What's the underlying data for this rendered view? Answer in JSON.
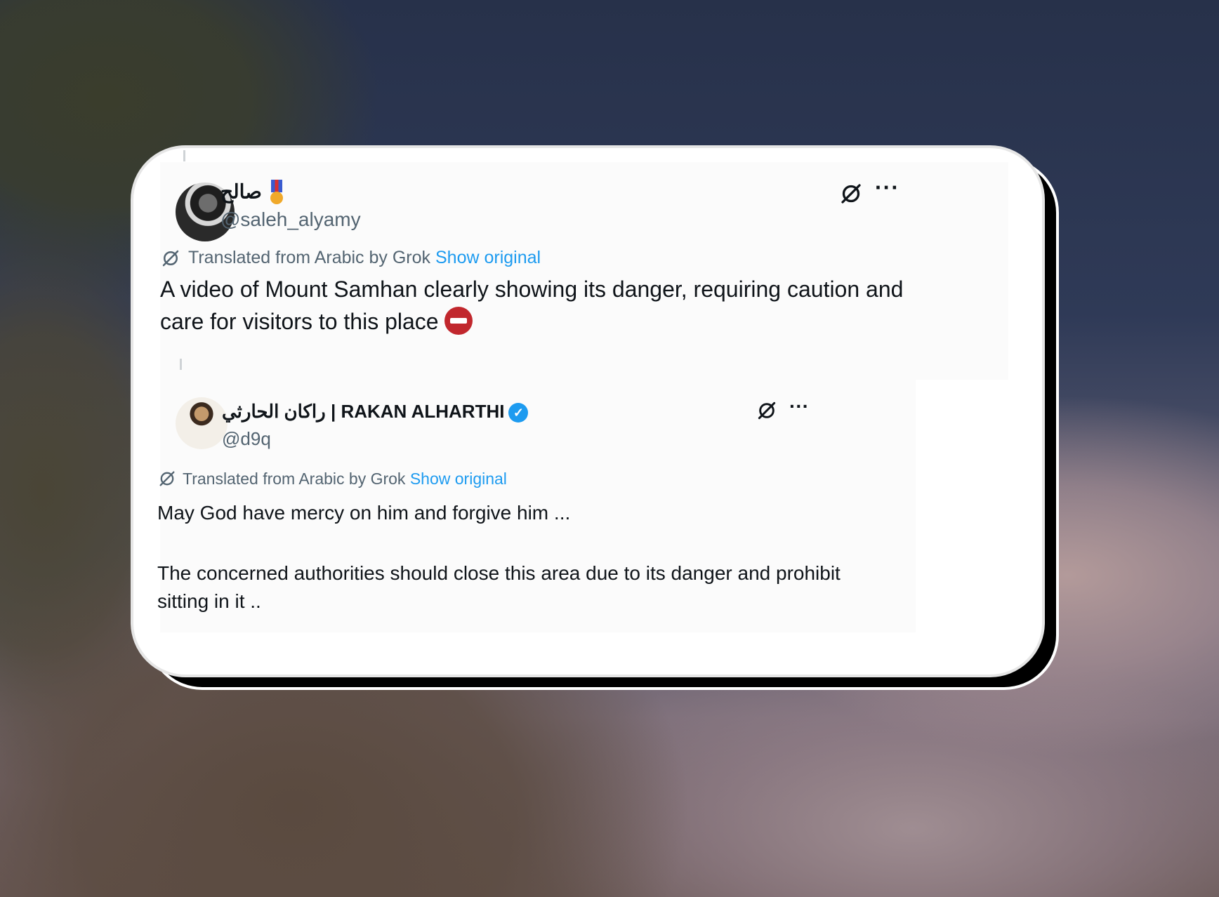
{
  "tweet": {
    "author_name": "صالح",
    "author_handle": "@saleh_alyamy",
    "translated_from": "Translated from Arabic by Grok",
    "show_original": "Show original",
    "text": "A video of Mount Samhan clearly showing its danger, requiring caution and care for visitors to this place",
    "more": "···"
  },
  "quote": {
    "author_name": "راكان الحارثي | RAKAN ALHARTHI",
    "verified": "✓",
    "author_handle": "@d9q",
    "translated_from": "Translated from Arabic by Grok",
    "show_original": "Show original",
    "text_line1": "May God have mercy on him and forgive him ...",
    "text_line2": "The concerned authorities should close this area due to its danger and prohibit sitting in it ..",
    "more": "···"
  },
  "icons": {
    "grok": "grok-translate-icon",
    "more": "more-options-icon",
    "stop": "no-entry-emoji",
    "medal": "military-medal-emoji",
    "verified": "verified-badge-icon"
  },
  "colors": {
    "link": "#1d9bf0",
    "text": "#0f1419",
    "muted": "#536471"
  }
}
